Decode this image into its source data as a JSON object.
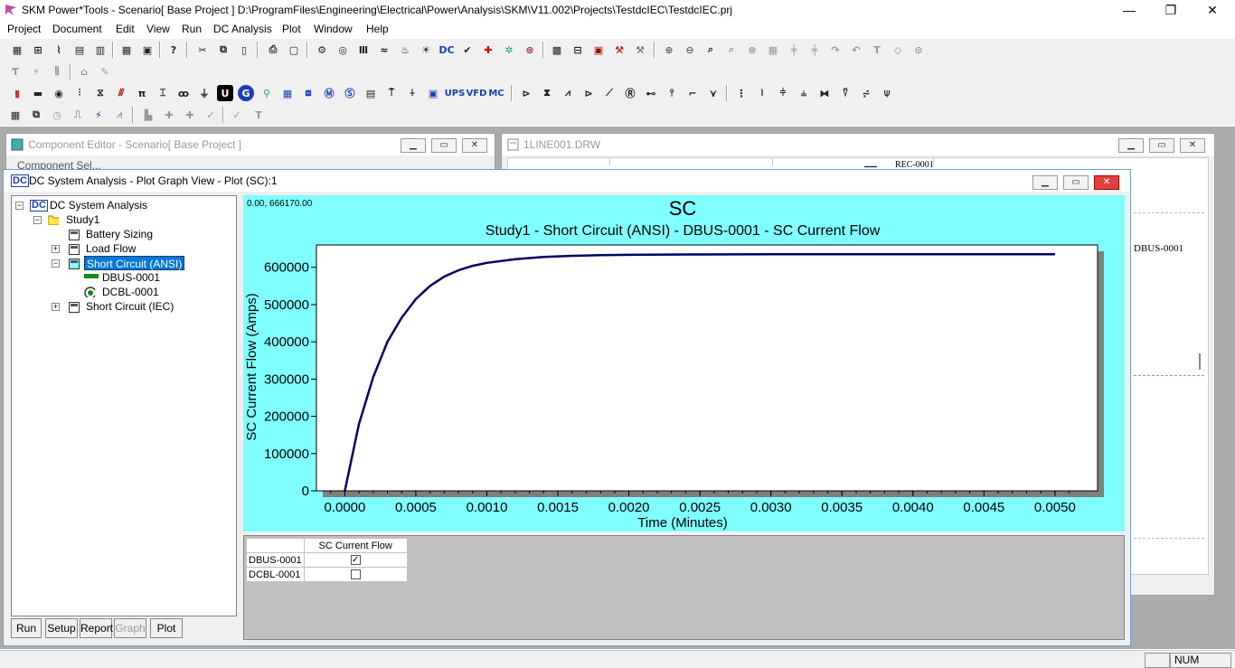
{
  "app": {
    "title": "SKM Power*Tools - Scenario[ Base Project ] D:\\ProgramFiles\\Engineering\\Electrical\\Power\\Analysis\\SKM\\V11.002\\Projects\\TestdcIEC\\TestdcIEC.prj",
    "window_controls": {
      "minimize": "—",
      "maximize": "❐",
      "close": "✕"
    }
  },
  "menubar": [
    "Project",
    "Document",
    "Edit",
    "View",
    "Run",
    "DC Analysis",
    "Plot",
    "Window",
    "Help"
  ],
  "toolbar_glyphs": {
    "dc": "DC",
    "ups": "UPS",
    "vfd": "VFD",
    "mc": "MC",
    "u": "U",
    "pi": "π",
    "t": "T"
  },
  "component_editor": {
    "title": "Component Editor  - Scenario[ Base Project ]",
    "partial_text": "Component Sel..."
  },
  "oneline": {
    "title": "1LINE001.DRW",
    "label_rec": "REC-0001",
    "label_dbus": "DBUS-0001"
  },
  "plot_window": {
    "title": "DC System Analysis - Plot Graph View - Plot (SC):1",
    "tree": {
      "root": "DC System Analysis",
      "study": "Study1",
      "items": [
        "Battery Sizing",
        "Load Flow",
        "Short Circuit (ANSI)",
        "Short Circuit (IEC)"
      ],
      "sc_children": [
        "DBUS-0001",
        "DCBL-0001"
      ],
      "selected": "Short Circuit (ANSI)"
    },
    "bottom_tabs": [
      "Run",
      "Setup",
      "Report",
      "Graph",
      "Plot"
    ],
    "coord_readout": "0.00, 666170.00",
    "legend": {
      "header": "SC Current Flow",
      "rows": [
        {
          "name": "DBUS-0001",
          "checked": "✓"
        },
        {
          "name": "DCBL-0001",
          "checked": ""
        }
      ]
    }
  },
  "chart_data": {
    "type": "line",
    "title": "SC",
    "subtitle": "Study1 - Short Circuit (ANSI) - DBUS-0001 - SC Current Flow",
    "xlabel": "Time (Minutes)",
    "ylabel": "SC Current Flow (Amps)",
    "xlim": [
      -0.0002,
      0.0053
    ],
    "ylim": [
      0,
      660000
    ],
    "xticks": [
      "0.0000",
      "0.0005",
      "0.0010",
      "0.0015",
      "0.0020",
      "0.0025",
      "0.0030",
      "0.0035",
      "0.0040",
      "0.0045",
      "0.0050"
    ],
    "yticks": [
      "0",
      "100000",
      "200000",
      "300000",
      "400000",
      "500000",
      "600000"
    ],
    "series": [
      {
        "color": "#000066",
        "x": [
          0.0,
          0.0001,
          0.0002,
          0.0003,
          0.0004,
          0.0005,
          0.0006,
          0.0007,
          0.0008,
          0.0009,
          0.001,
          0.0012,
          0.0014,
          0.0016,
          0.0018,
          0.002,
          0.0025,
          0.003,
          0.0035,
          0.004,
          0.0045,
          0.005
        ],
        "y": [
          0,
          180000,
          305000,
          400000,
          465000,
          515000,
          550000,
          575000,
          592000,
          604000,
          612000,
          622000,
          628000,
          631000,
          632500,
          633500,
          634500,
          635000,
          635000,
          635000,
          635000,
          635000
        ]
      }
    ]
  },
  "statusbar": {
    "num": "NUM"
  }
}
